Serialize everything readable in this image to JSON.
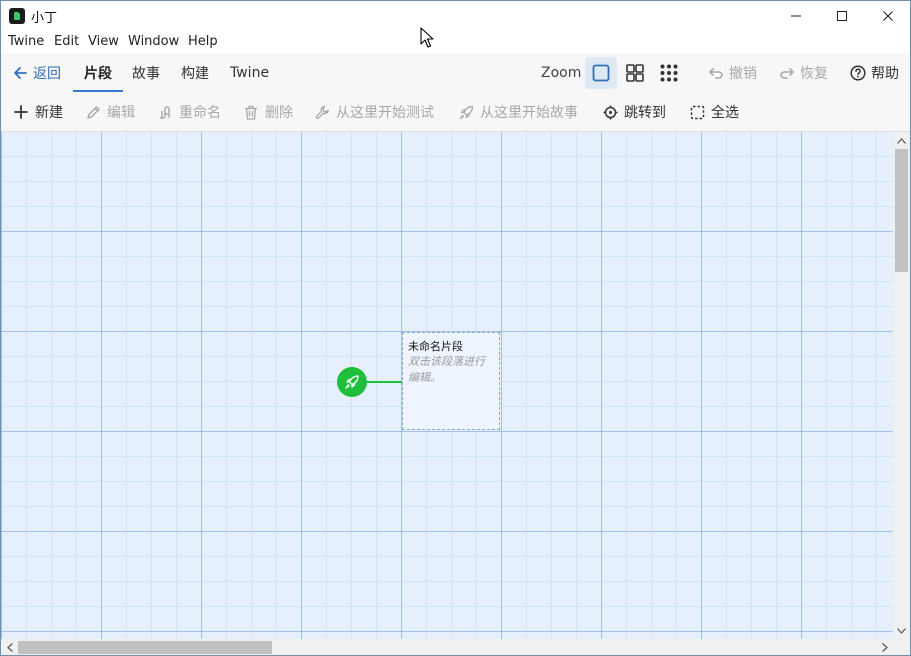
{
  "window": {
    "title": "小丁"
  },
  "menu": [
    "Twine",
    "Edit",
    "View",
    "Window",
    "Help"
  ],
  "header": {
    "back_label": "返回",
    "tabs": [
      "片段",
      "故事",
      "构建",
      "Twine"
    ],
    "active_tab": "片段",
    "zoom_label": "Zoom",
    "undo_label": "撤销",
    "redo_label": "恢复",
    "help_label": "帮助"
  },
  "toolbar": {
    "new_label": "新建",
    "edit_label": "编辑",
    "rename_label": "重命名",
    "delete_label": "删除",
    "test_from_here_label": "从这里开始测试",
    "story_from_here_label": "从这里开始故事",
    "go_to_label": "跳转到",
    "select_all_label": "全选"
  },
  "passage": {
    "title": "未命名片段",
    "excerpt": "双击该段落进行编辑。"
  },
  "colors": {
    "accent": "#3a78c9",
    "start_marker": "#1fbf3b",
    "canvas_bg": "#e6f0fc",
    "disabled_text": "#a8a8a8"
  }
}
